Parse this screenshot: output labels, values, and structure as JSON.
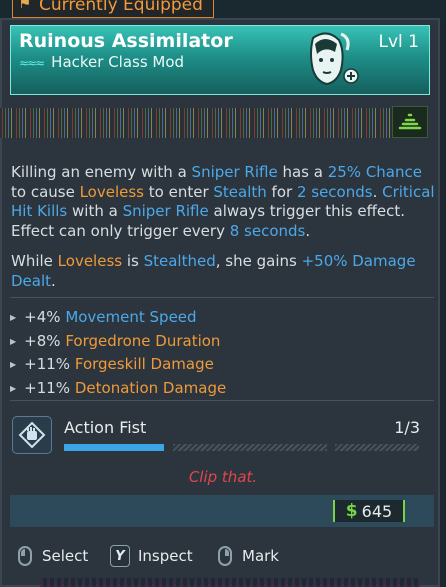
{
  "equipped_tag": "Currently Equipped",
  "item": {
    "name": "Ruinous Assimilator",
    "class_type": "Hacker Class Mod",
    "level": "Lvl 1",
    "header_color": "#2fb3a8"
  },
  "description": {
    "p1": [
      {
        "t": "Killing an enemy with a ",
        "c": "w"
      },
      {
        "t": "Sniper Rifle",
        "c": "b"
      },
      {
        "t": " has a ",
        "c": "w"
      },
      {
        "t": "25% Chance",
        "c": "b"
      },
      {
        "t": " to cause ",
        "c": "w"
      },
      {
        "t": "Loveless",
        "c": "o"
      },
      {
        "t": " to enter ",
        "c": "w"
      },
      {
        "t": "Stealth",
        "c": "b"
      },
      {
        "t": " for ",
        "c": "w"
      },
      {
        "t": "2 seconds",
        "c": "b"
      },
      {
        "t": ". ",
        "c": "w"
      },
      {
        "t": "Critical Hit Kills",
        "c": "b"
      },
      {
        "t": " with a ",
        "c": "w"
      },
      {
        "t": "Sniper Rifle",
        "c": "b"
      },
      {
        "t": " always trigger this effect. Effect can only trigger every ",
        "c": "w"
      },
      {
        "t": "8 seconds",
        "c": "b"
      },
      {
        "t": ".",
        "c": "w"
      }
    ],
    "p2": [
      {
        "t": "While ",
        "c": "w"
      },
      {
        "t": "Loveless",
        "c": "o"
      },
      {
        "t": " is ",
        "c": "w"
      },
      {
        "t": "Stealthed",
        "c": "b"
      },
      {
        "t": ", she gains ",
        "c": "w"
      },
      {
        "t": "+50% Damage Dealt",
        "c": "b"
      },
      {
        "t": ".",
        "c": "w"
      }
    ]
  },
  "stats": [
    {
      "value": "+4%",
      "name": "Movement Speed",
      "color": "b"
    },
    {
      "value": "+8%",
      "name": "Forgedrone Duration",
      "color": "o"
    },
    {
      "value": "+11%",
      "name": "Forgeskill Damage",
      "color": "o"
    },
    {
      "value": "+11%",
      "name": "Detonation Damage",
      "color": "o"
    }
  ],
  "skill": {
    "name": "Action Fist",
    "points": "1/3",
    "filled": 1,
    "total": 3
  },
  "flavor_text": "Clip that.",
  "price": {
    "currency_symbol": "$",
    "value": "645"
  },
  "prompts": {
    "select": "Select",
    "inspect_key": "Y",
    "inspect": "Inspect",
    "mark": "Mark"
  },
  "colors": {
    "accent_blue": "#4da8e8",
    "accent_orange": "#ef9a3a",
    "flavor_red": "#e0474c",
    "money_green": "#78d34a"
  }
}
